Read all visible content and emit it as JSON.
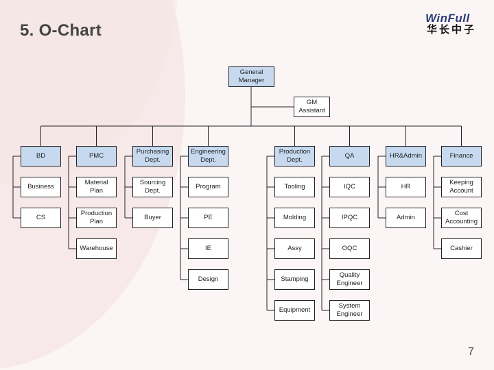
{
  "slide": {
    "title": "5.  O-Chart",
    "page_number": "7",
    "logo": {
      "name_en": "WinFull",
      "name_cn": "华长中子"
    }
  },
  "colors": {
    "department_head_fill": "#c6d9ef",
    "box_fill": "#ffffff",
    "line": "#222222",
    "title_text": "#444444"
  },
  "org_chart": {
    "top": {
      "label": "General\nManager"
    },
    "assistant": {
      "label": "GM\nAssistant"
    },
    "departments": [
      {
        "label": "BD",
        "children": [
          "Business",
          "CS"
        ]
      },
      {
        "label": "PMC",
        "children": [
          "Material Plan",
          "Production\nPlan",
          "Warehouse"
        ]
      },
      {
        "label": "Purchasing\nDept.",
        "children": [
          "Sourcing\nDept.",
          "Buyer"
        ]
      },
      {
        "label": "Engineering\nDept.",
        "children": [
          "Program",
          "PE",
          "IE",
          "Design"
        ]
      },
      {
        "label": "Production\nDept.",
        "children": [
          "Tooling",
          "Molding",
          "Assy",
          "Stamping",
          "Equipment"
        ]
      },
      {
        "label": "QA",
        "children": [
          "IQC",
          "IPQC",
          "OQC",
          "Quality\nEngineer",
          "System\nEngineer"
        ]
      },
      {
        "label": "HR&Admin",
        "children": [
          "HR",
          "Admin"
        ]
      },
      {
        "label": "Finance",
        "children": [
          "Keeping\nAccount",
          "Cost\nAccounting",
          "Cashier"
        ]
      }
    ]
  }
}
